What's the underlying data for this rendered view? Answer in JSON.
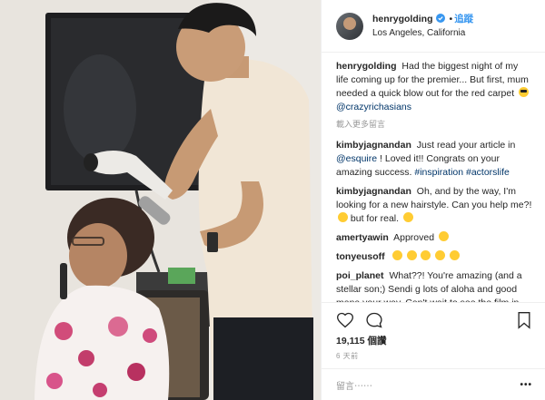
{
  "header": {
    "username": "henrygolding",
    "separator": "•",
    "follow_label": "追蹤",
    "location": "Los Angeles, California"
  },
  "caption": {
    "username": "henrygolding",
    "text": "Had the biggest night of my life coming up for the premier... But first, mum needed a quick blow out for the red carpet",
    "tag": "@crazyrichasians"
  },
  "translate_label": "載入更多留言",
  "comments": [
    {
      "username": "kimbyjagnandan",
      "text": "Just read your article in ",
      "link": "@esquire",
      "text2": " ! Loved it!! Congrats on your amazing success. ",
      "tags": "#inspiration #actorslife"
    },
    {
      "username": "kimbyjagnandan",
      "text": "Oh, and by the way, I'm looking for a new hairstyle. Can you help me?!",
      "text2": " but for real."
    },
    {
      "username": "amertyawin",
      "text": "Approved"
    },
    {
      "username": "tonyeusoff",
      "text": ""
    },
    {
      "username": "poi_planet",
      "text": "What??! You're amazing (and a stellar son;) Sendi g lots of aloha and good mana your way. Can't wait to see the film in Hawaii!!"
    }
  ],
  "likes": "19,115 個讚",
  "timestamp": "6 天前",
  "add_comment_placeholder": "留言⋯⋯",
  "more_label": "•••",
  "icons": [
    "verified-badge-icon",
    "heart-icon",
    "comment-icon",
    "bookmark-icon",
    "more-icon"
  ],
  "colors": {
    "link": "#003569",
    "follow": "#3897f0",
    "verified": "#3897f0",
    "border": "#efefef"
  }
}
